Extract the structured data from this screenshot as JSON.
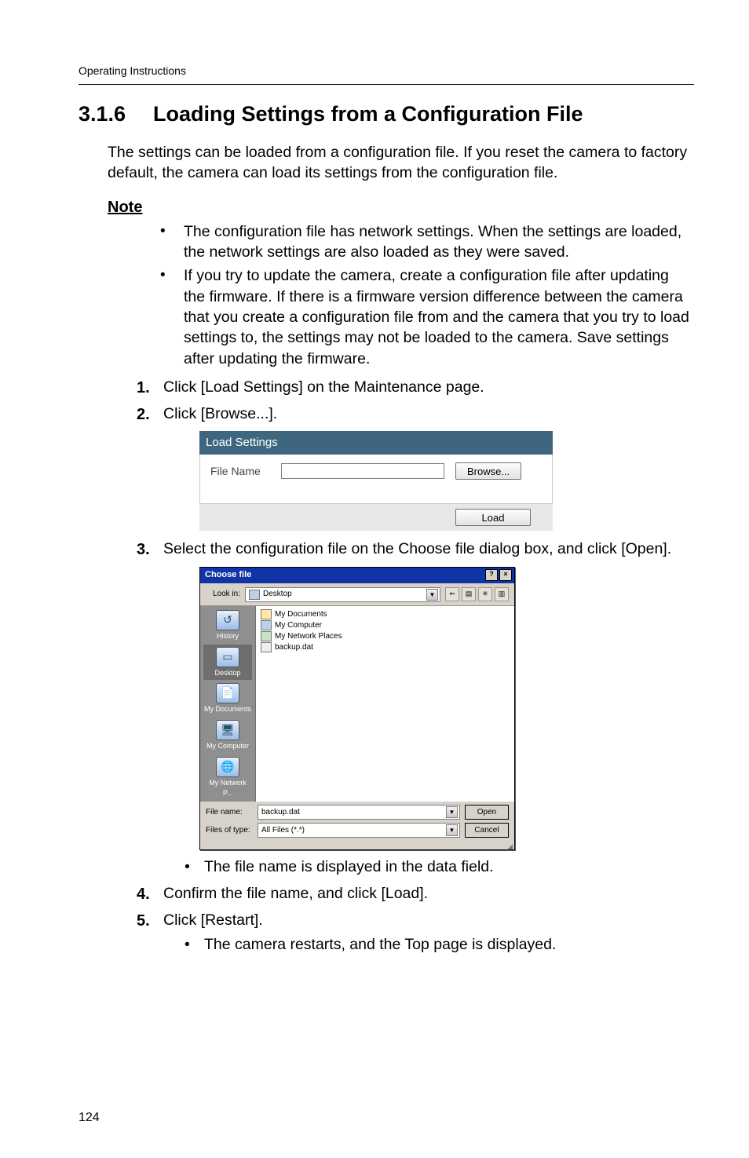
{
  "running_head": "Operating Instructions",
  "section": {
    "number": "3.1.6",
    "title": "Loading Settings from a Configuration File"
  },
  "intro": "The settings can be loaded from a configuration file. If you reset the camera to factory default, the camera can load its settings from the configuration file.",
  "note_heading": "Note",
  "notes": [
    "The configuration file has network settings. When the settings are loaded, the network settings are also loaded as they were saved.",
    "If you try to update the camera, create a configuration file after updating the firmware. If there is a firmware version difference between the camera that you create a configuration file from and the camera that you try to load settings to, the settings may not be loaded to the camera. Save settings after updating the firmware."
  ],
  "steps": {
    "s1": "Click [Load Settings] on the Maintenance page.",
    "s2": "Click [Browse...].",
    "s3": "Select the configuration file on the Choose file dialog box, and click [Open].",
    "s3_sub": "The file name is displayed in the data field.",
    "s4": "Confirm the file name, and click [Load].",
    "s5": "Click [Restart].",
    "s5_sub": "The camera restarts, and the Top page is displayed."
  },
  "load_panel": {
    "title": "Load Settings",
    "file_label": "File Name",
    "browse": "Browse...",
    "load": "Load"
  },
  "choose_dialog": {
    "title": "Choose file",
    "lookin": "Look in:",
    "lookin_value": "Desktop",
    "places": {
      "history": "History",
      "desktop": "Desktop",
      "mydocs": "My Documents",
      "mycomp": "My Computer",
      "mynet": "My Network P..."
    },
    "files": {
      "f1": "My Documents",
      "f2": "My Computer",
      "f3": "My Network Places",
      "f4": "backup.dat"
    },
    "filename_label": "File name:",
    "filename_value": "backup.dat",
    "filetype_label": "Files of type:",
    "filetype_value": "All Files (*.*)",
    "open": "Open",
    "cancel": "Cancel",
    "help_glyph": "?",
    "close_glyph": "×"
  },
  "page_number": "124"
}
